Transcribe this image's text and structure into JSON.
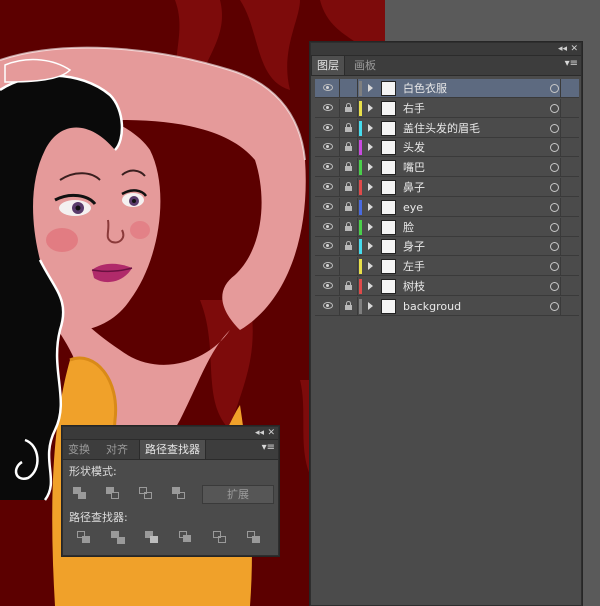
{
  "layers_panel": {
    "collapse_glyph": "◂◂",
    "close_glyph": "✕",
    "tabs": [
      {
        "label": "图层"
      },
      {
        "label": "画板"
      }
    ],
    "menu_icon": "panel-menu-icon",
    "layers": [
      {
        "name": "白色衣服",
        "color": "#7f7f7f",
        "locked": false,
        "selected": true
      },
      {
        "name": "右手",
        "color": "#e8e04a",
        "locked": true,
        "selected": false
      },
      {
        "name": "盖住头发的眉毛",
        "color": "#46dcee",
        "locked": true,
        "selected": false
      },
      {
        "name": "头发",
        "color": "#c84ae0",
        "locked": true,
        "selected": false
      },
      {
        "name": "嘴巴",
        "color": "#4ad04a",
        "locked": true,
        "selected": false
      },
      {
        "name": "鼻子",
        "color": "#e04a4a",
        "locked": true,
        "selected": false
      },
      {
        "name": "eye",
        "color": "#4a6ae0",
        "locked": true,
        "selected": false
      },
      {
        "name": "脸",
        "color": "#4ad04a",
        "locked": true,
        "selected": false
      },
      {
        "name": "身子",
        "color": "#46dcee",
        "locked": true,
        "selected": false
      },
      {
        "name": "左手",
        "color": "#e8e04a",
        "locked": false,
        "selected": false
      },
      {
        "name": "树枝",
        "color": "#e04a4a",
        "locked": true,
        "selected": false
      },
      {
        "name": "backgroud",
        "color": "#7f7f7f",
        "locked": true,
        "selected": false
      }
    ]
  },
  "pathfinder_panel": {
    "collapse_glyph": "◂◂",
    "close_glyph": "✕",
    "tabs": [
      {
        "label": "变换"
      },
      {
        "label": "对齐"
      },
      {
        "label": "路径查找器"
      }
    ],
    "shape_modes_label": "形状模式:",
    "expand_label": "扩展",
    "pathfinders_label": "路径查找器:"
  },
  "colors": {
    "background_red": "#5c0000",
    "skin": "#e59a9a",
    "hair": "#0a0a0a",
    "dress": "#f0a12a",
    "workspace_gray": "#5a5a5a",
    "panel_bg": "#4b4b4b",
    "selection": "#5d6a80"
  }
}
